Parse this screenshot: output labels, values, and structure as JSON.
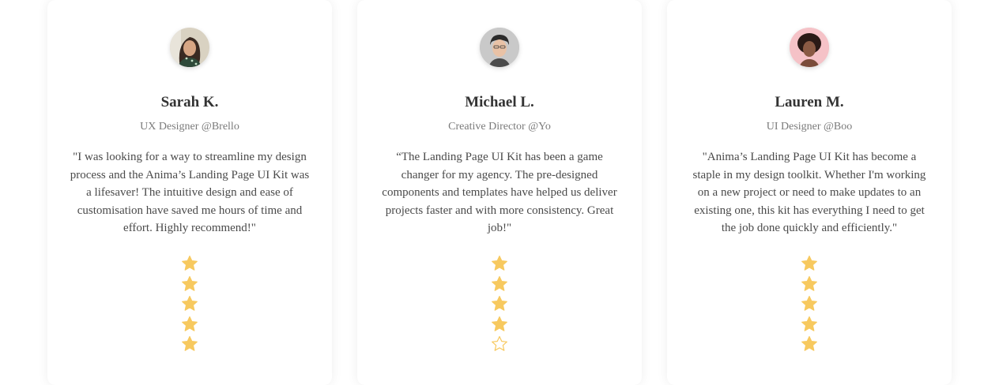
{
  "colors": {
    "star_fill": "#f7c95f",
    "star_stroke": "#f7c95f",
    "name_text": "#333333",
    "role_text": "#7a7a7a",
    "quote_text": "#4a4a4a"
  },
  "testimonials": [
    {
      "name": "Sarah K.",
      "role": "UX Designer @Brello",
      "quote": "\"I was looking for a way to streamline my design process and the Anima’s Landing Page UI Kit was a lifesaver! The intuitive design and ease of customisation have saved me hours of time and effort. Highly recommend!\"",
      "rating": 5,
      "max_rating": 5,
      "avatar_icon": "avatar-photo"
    },
    {
      "name": "Michael L.",
      "role": "Creative Director @Yo",
      "quote": "“The Landing Page UI Kit has been a game changer for my agency. The pre-designed components and templates have helped us deliver projects faster and with more consistency. Great job!\"",
      "rating": 4,
      "max_rating": 5,
      "avatar_icon": "avatar-photo"
    },
    {
      "name": "Lauren M.",
      "role": "UI Designer @Boo",
      "quote": "\"Anima’s Landing Page UI Kit has become a staple in my design toolkit. Whether I'm working on a new project or need to make updates to an existing one, this kit has everything I need to get the job done quickly and efficiently.\"",
      "rating": 5,
      "max_rating": 5,
      "avatar_icon": "avatar-photo"
    }
  ]
}
